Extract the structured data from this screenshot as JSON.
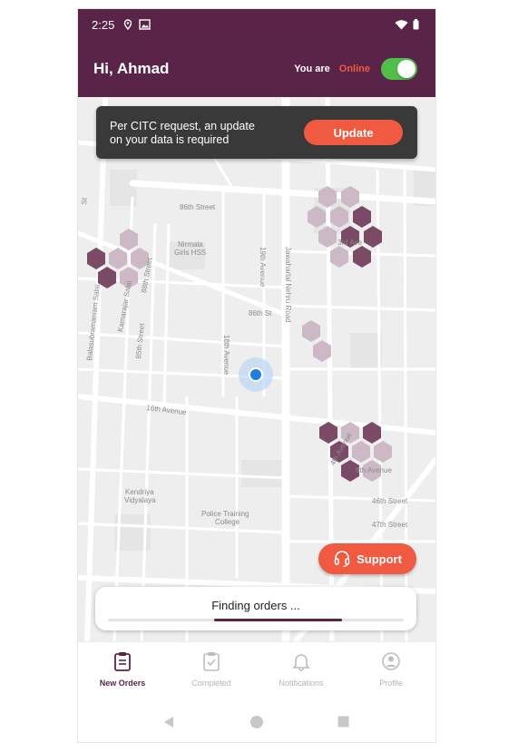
{
  "status_bar": {
    "time": "2:25"
  },
  "header": {
    "greeting": "Hi, Ahmad",
    "status_prefix": "You are",
    "status_value": "Online"
  },
  "banner": {
    "line1": "Per CITC request, an update",
    "line2": "on your data is required",
    "button": "Update"
  },
  "map_labels": {
    "s86th_street": "86th Street",
    "nirmala_1": "Nirmala",
    "nirmala_2": "Girls HSS",
    "s88th_street": "88th Street",
    "s19th_avenue": "19th Avenue",
    "jawaharlal": "Jawaharlal Nehru Road",
    "s86th_st": "86th St",
    "s18th_avenue": "18th Avenue",
    "kamarajar": "Kamarajar Salai",
    "balasubramaniam": "Balasubramaniam Salai",
    "s85th_street": "85th Street",
    "s16th_avenue": "16th Avenue",
    "third_ave": "3rd Ave",
    "fourth_avenue": "4th Avenue",
    "eighth_avenue": "8th Avenue",
    "s46th_street": "46th Street",
    "s47th_street": "47th Street",
    "kendriya_1": "Kendriya",
    "kendriya_2": "Vidyalaya",
    "police_1": "Police Training",
    "police_2": "College",
    "left_st": "St"
  },
  "support": {
    "label": "Support"
  },
  "finding": {
    "text": "Finding orders ...",
    "progress_start": 0.36,
    "progress_end": 0.79
  },
  "nav": {
    "items": [
      {
        "label": "New Orders",
        "icon": "clipboard-icon"
      },
      {
        "label": "Completed",
        "icon": "clipboard-check-icon"
      },
      {
        "label": "Notifications",
        "icon": "bell-icon"
      },
      {
        "label": "Profile",
        "icon": "user-circle-icon"
      }
    ]
  },
  "colors": {
    "brand": "#5a2449",
    "accent": "#ef5a40",
    "online": "#4fbf4a",
    "hex_dark": "#7a4a66",
    "hex_light": "#cdb9c5"
  }
}
